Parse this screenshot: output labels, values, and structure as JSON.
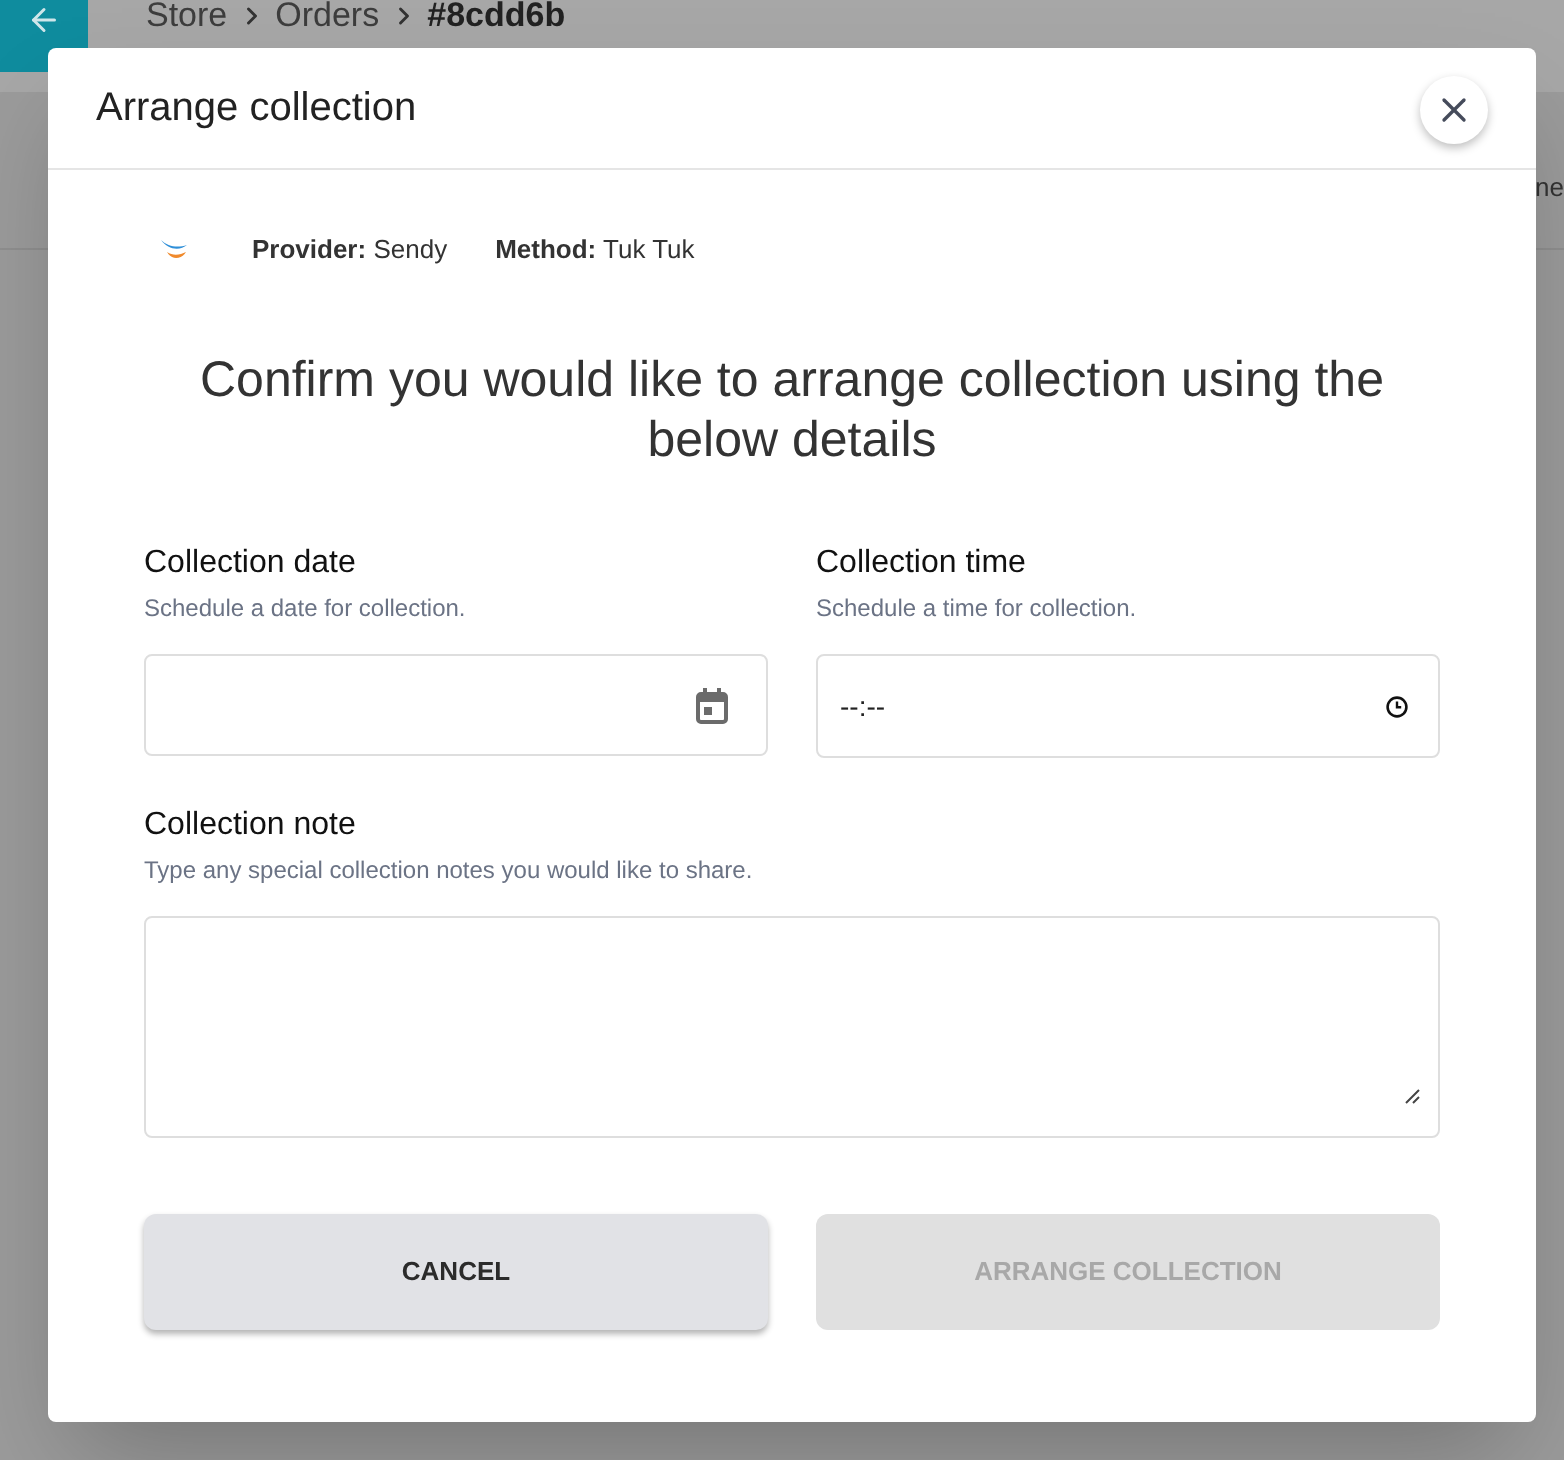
{
  "background": {
    "breadcrumb": [
      {
        "label": "Store",
        "current": false
      },
      {
        "label": "Orders",
        "current": false
      },
      {
        "label": "#8cdd6b",
        "current": true
      }
    ],
    "side_text": "ne"
  },
  "dialog": {
    "title": "Arrange collection",
    "provider": {
      "label": "Provider:",
      "value": "Sendy"
    },
    "method": {
      "label": "Method:",
      "value": "Tuk Tuk"
    },
    "heading": "Confirm you would like to arrange collection using the below details",
    "fields": [
      {
        "kind": "date",
        "label": "Collection date",
        "hint": "Schedule a date for collection."
      },
      {
        "kind": "time",
        "label": "Collection time",
        "hint": "Schedule a time for collection.",
        "placeholder": "--:--"
      },
      {
        "kind": "textarea",
        "label": "Collection note",
        "hint": "Type any special collection notes you would like to share."
      }
    ],
    "buttons": [
      {
        "label": "CANCEL",
        "disabled": false
      },
      {
        "label": "ARRANGE COLLECTION",
        "disabled": true
      }
    ]
  }
}
